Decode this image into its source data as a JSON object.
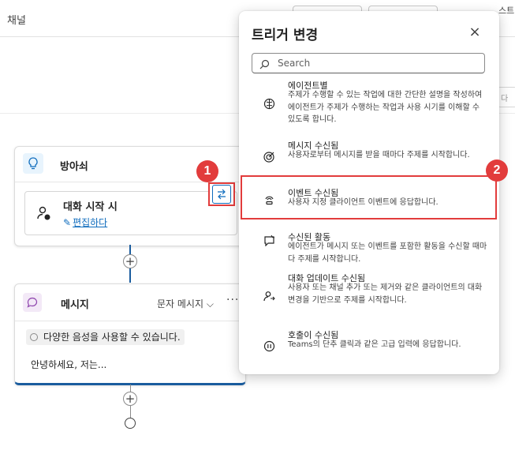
{
  "topbar": {
    "tab_title": "채널",
    "right_text": "스트"
  },
  "sidebar": {
    "box_text": "다"
  },
  "trigger_card": {
    "title": "방아쇠",
    "trigger_name": "대화 시작 시",
    "edit_label": "편집하다",
    "change_icon": "swap-arrows"
  },
  "callouts": {
    "one": "1",
    "two": "2"
  },
  "message_card": {
    "title": "메시지",
    "type_label": "문자 메시지",
    "more_label": "···",
    "voice_chip": "다양한 음성을 사용할 수 있습니다.",
    "text": "안녕하세요, 저는..."
  },
  "add_label": "+",
  "panel": {
    "title": "트리거 변경",
    "close_label": "×",
    "search_placeholder": "Search",
    "items": [
      {
        "icon": "brain-icon",
        "title": "에이전트별",
        "desc": "주제가 수행할 수 있는 작업에 대한 간단한 설명을 작성하여 에이전트가 주제가 수행하는 작업과 사용 시기를 이해할 수 있도록 합니다."
      },
      {
        "icon": "target-icon",
        "title": "메시지 수신됨",
        "desc": "사용자로부터 메시지를 받을 때마다 주제를 시작합니다."
      },
      {
        "icon": "signal-icon",
        "title": "이벤트 수신됨",
        "desc": "사용자 지정 클라이언트 이벤트에 응답합니다."
      },
      {
        "icon": "activity-icon",
        "title": "수신된 활동",
        "desc": "에이전트가 메시지 또는 이벤트를 포함한 활동을 수신할 때마다 주제를 시작합니다."
      },
      {
        "icon": "conversation-update-icon",
        "title": "대화 업데이트 수신됨",
        "desc": "사용자 또는 채널 추가 또는 제거와 같은 클라이언트의 대화 변경을 기반으로 주제를 시작합니다."
      },
      {
        "icon": "invoke-icon",
        "title": "호출이 수신됨",
        "desc": "Teams의 단추 클릭과 같은 고급 입력에 응답합니다."
      }
    ]
  },
  "colors": {
    "accent": "#0f6cbd",
    "callout": "#e23c3c",
    "connector": "#1a5c9e"
  }
}
